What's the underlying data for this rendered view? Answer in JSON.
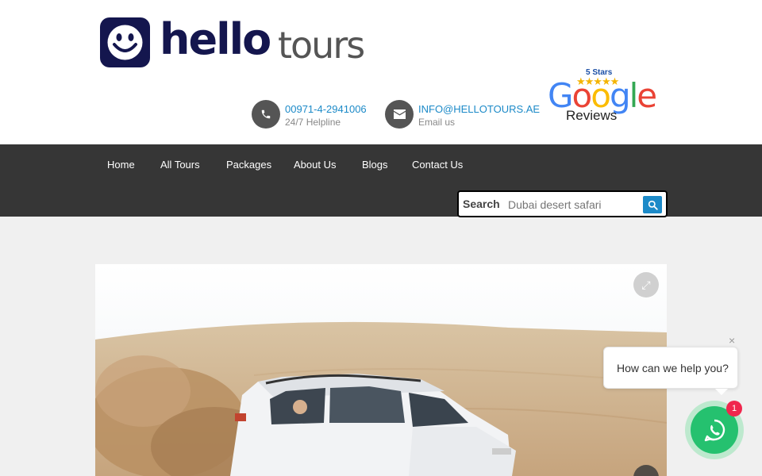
{
  "brand": {
    "hello": "hello",
    "tours": "tours",
    "brand_color": "#14164e"
  },
  "contacts": [
    {
      "icon": "phone-icon",
      "value": "00971-4-2941006",
      "label": "24/7 Helpline"
    },
    {
      "icon": "envelope-icon",
      "value": "INFO@HELLOTOURS.AE",
      "label": "Email us"
    }
  ],
  "google_badge": {
    "stars_label": "5 Stars",
    "stars": "★★★★★",
    "rating": 5,
    "word": "Google",
    "sub": "Reviews"
  },
  "nav": {
    "items": [
      "Home",
      "All Tours",
      "Packages",
      "About Us",
      "Blogs",
      "Contact Us"
    ]
  },
  "search": {
    "label": "Search",
    "placeholder": "Dubai desert safari",
    "icon": "search-icon"
  },
  "hero": {
    "expand_icon": "expand-icon",
    "next_icon": "chevron-right-icon"
  },
  "chat": {
    "message": "How can we help you?",
    "close": "×",
    "badge": "1",
    "icon": "whatsapp-icon"
  },
  "colors": {
    "accent": "#1c8ac8",
    "nav_bg": "#363636",
    "whatsapp": "#25c16f",
    "badge": "#f0264d"
  }
}
